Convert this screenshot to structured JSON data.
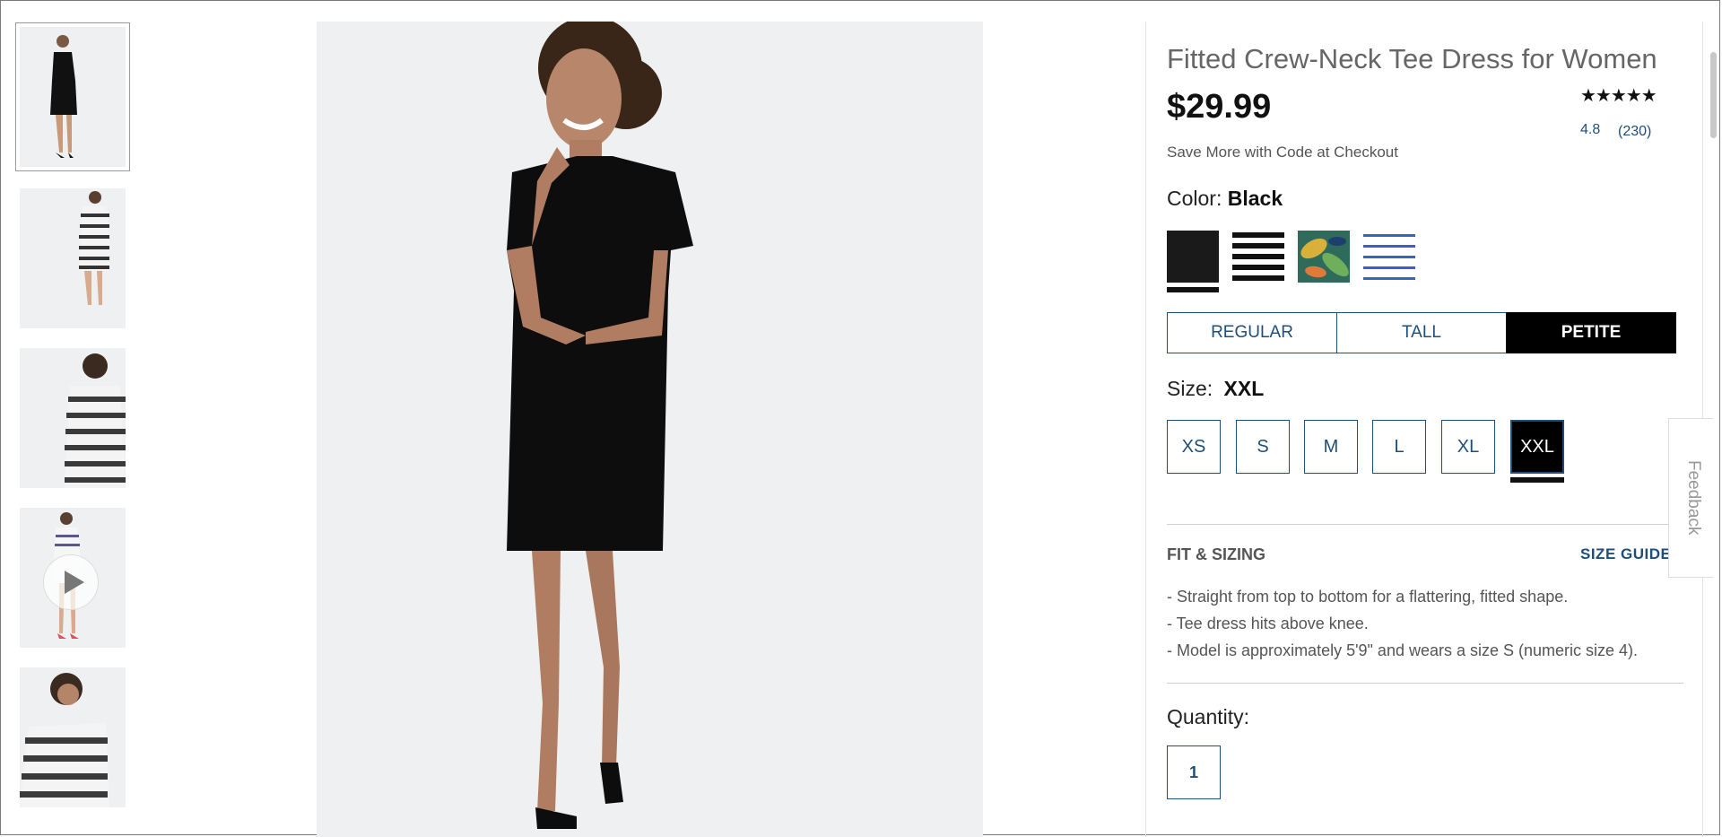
{
  "product": {
    "title": "Fitted Crew-Neck Tee Dress for Women",
    "price": "$29.99",
    "stars": "★★★★★",
    "rating": "4.8",
    "reviews": "(230)",
    "promo": "Save More with Code at Checkout"
  },
  "color": {
    "label": "Color:",
    "selected": "Black",
    "swatches": [
      {
        "name": "Black",
        "hex": "#1a1a1a"
      },
      {
        "name": "Black Stripe",
        "hex": "#111111"
      },
      {
        "name": "Tropical Print",
        "hex": "#2e6b5a"
      },
      {
        "name": "Blue Stripe",
        "hex": "#3f5fc8"
      }
    ]
  },
  "fit": {
    "options": [
      "REGULAR",
      "TALL",
      "PETITE"
    ],
    "selected": "PETITE"
  },
  "size": {
    "label": "Size:",
    "selected": "XXL",
    "options": [
      "XS",
      "S",
      "M",
      "L",
      "XL",
      "XXL"
    ]
  },
  "details": {
    "heading": "FIT & SIZING",
    "size_guide": "SIZE GUIDE",
    "bullets": [
      "Straight from top to bottom for a flattering, fitted shape.",
      "Tee dress hits above knee.",
      "Model is approximately 5'9\" and wears a size S (numeric size 4)."
    ]
  },
  "quantity": {
    "label": "Quantity:",
    "value": "1"
  },
  "feedback": {
    "label": "Feedback"
  },
  "colors": {
    "accent": "#1f4e79",
    "selected_bg": "#000000"
  }
}
